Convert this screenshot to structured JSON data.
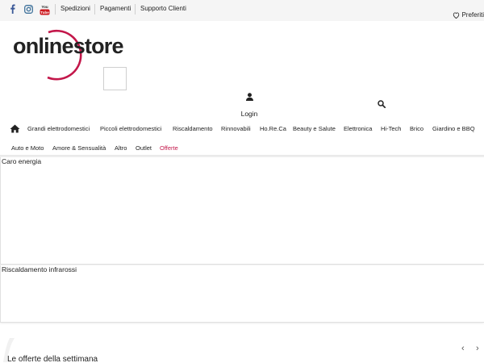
{
  "topbar": {
    "social": [
      {
        "name": "facebook-icon",
        "glyph": "f"
      },
      {
        "name": "instagram-icon",
        "glyph": ""
      },
      {
        "name": "youtube-icon",
        "glyph": "You Tube"
      }
    ],
    "links": [
      "Spedizioni",
      "Pagamenti",
      "Supporto Clienti"
    ],
    "favorites_label": "Preferiti"
  },
  "logo": {
    "text": "onlinestore",
    "accent_color": "#c3174a"
  },
  "header": {
    "login_label": "Login"
  },
  "nav": {
    "row1": [
      "Grandi elettrodomestici",
      "Piccoli elettrodomestici",
      "Riscaldamento",
      "Rinnovabili",
      "Ho.Re.Ca",
      "Beauty e Salute",
      "Elettronica",
      "Hi-Tech",
      "Brico",
      "Giardino e BBQ"
    ],
    "row2": [
      "Auto e Moto",
      "Amore & Sensualità",
      "Altro",
      "Outlet",
      "Offerte"
    ]
  },
  "panels": [
    {
      "title": "Caro energia"
    },
    {
      "title": "Riscaldamento infrarossi"
    }
  ],
  "offers": {
    "heading": "Le offerte della settimana",
    "prev_label": "‹",
    "next_label": "›"
  },
  "colors": {
    "brand": "#c3174a",
    "facebook": "#3b5998",
    "youtube": "#cc181e",
    "instagram": "#3f729b"
  }
}
